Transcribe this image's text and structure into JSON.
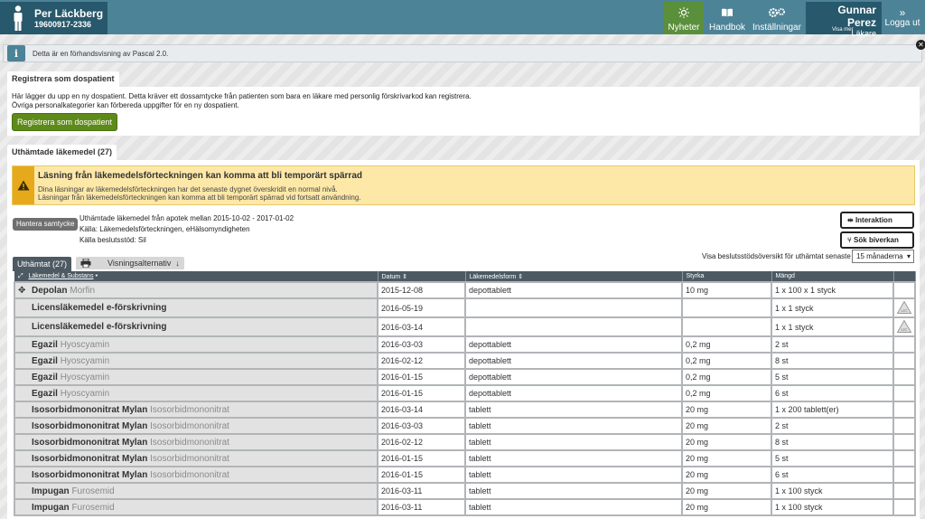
{
  "header": {
    "patient_name": "Per Läckberg",
    "patient_id": "19600917-2336",
    "nav": [
      {
        "label": "Nyheter"
      },
      {
        "label": "Handbok"
      },
      {
        "label": "Inställningar"
      }
    ],
    "user_name": "Gunnar Perez",
    "user_role": "Läkare",
    "user_more": "Visa mer",
    "logout": "Logga ut"
  },
  "info": {
    "text": "Detta är en förhandsvisning av Pascal 2.0."
  },
  "dospatient": {
    "tab": "Registrera som dospatient",
    "line1": "Här lägger du upp en ny dospatient. Detta kräver ett dossamtycke från patienten som bara en läkare med personlig förskrivarkod kan registrera.",
    "line2": "Övriga personalkategorier kan förbereda uppgifter för en ny dospatient.",
    "button": "Registrera som dospatient"
  },
  "uthamtade": {
    "tab": "Uthämtade läkemedel (27)",
    "warning_title": "Läsning från läkemedelsförteckningen kan komma att bli temporärt spärrad",
    "warning_line1": "Dina läsningar av läkemedelsförteckningen har det senaste dygnet överskridit en normal nivå.",
    "warning_line2": "Läsningar från läkemedelsförteckningen kan komma att bli temporärt spärrad vid fortsatt användning.",
    "consent_button": "Hantera samtycke",
    "source_line1": "Uthämtade läkemedel från apotek mellan 2015-10-02 - 2017-01-02",
    "source_line2": "Källa: Läkemedelsförteckningen, eHälsomyndigheten",
    "source_line3": "Källa beslutsstöd: Sil",
    "interaction_button": "Interaktion",
    "sideeffect_button": "Sök biverkan",
    "overview_label": "Visa beslutsstödsöversikt för uthämtat senaste",
    "period_select": "15 månaderna",
    "table_tab": "Uthämtat (27)",
    "view_tab": "Visningsalternativ",
    "columns": [
      "Läkemedel & Substans",
      "Datum",
      "Läkemedelsform",
      "Styrka",
      "Mängd"
    ],
    "rows": [
      {
        "name": "Depolan",
        "substance": "Morfin",
        "date": "2015-12-08",
        "form": "depottablett",
        "strength": "10 mg",
        "amount": "1 x 100 x 1 styck"
      },
      {
        "name": "Licensläkemedel e-förskrivning",
        "substance": "",
        "date": "2016-05-19",
        "form": "",
        "strength": "",
        "amount": "1 x 1 styck",
        "lic": "LIC"
      },
      {
        "name": "Licensläkemedel e-förskrivning",
        "substance": "",
        "date": "2016-03-14",
        "form": "",
        "strength": "",
        "amount": "1 x 1 styck",
        "lic": "LIC"
      },
      {
        "name": "Egazil",
        "substance": "Hyoscyamin",
        "date": "2016-03-03",
        "form": "depottablett",
        "strength": "0,2 mg",
        "amount": "2 st"
      },
      {
        "name": "Egazil",
        "substance": "Hyoscyamin",
        "date": "2016-02-12",
        "form": "depottablett",
        "strength": "0,2 mg",
        "amount": "8 st"
      },
      {
        "name": "Egazil",
        "substance": "Hyoscyamin",
        "date": "2016-01-15",
        "form": "depottablett",
        "strength": "0,2 mg",
        "amount": "5 st"
      },
      {
        "name": "Egazil",
        "substance": "Hyoscyamin",
        "date": "2016-01-15",
        "form": "depottablett",
        "strength": "0,2 mg",
        "amount": "6 st"
      },
      {
        "name": "Isosorbidmononitrat Mylan",
        "substance": "Isosorbidmononitrat",
        "date": "2016-03-14",
        "form": "tablett",
        "strength": "20 mg",
        "amount": "1 x 200 tablett(er)"
      },
      {
        "name": "Isosorbidmononitrat Mylan",
        "substance": "Isosorbidmononitrat",
        "date": "2016-03-03",
        "form": "tablett",
        "strength": "20 mg",
        "amount": "2 st"
      },
      {
        "name": "Isosorbidmononitrat Mylan",
        "substance": "Isosorbidmononitrat",
        "date": "2016-02-12",
        "form": "tablett",
        "strength": "20 mg",
        "amount": "8 st"
      },
      {
        "name": "Isosorbidmononitrat Mylan",
        "substance": "Isosorbidmononitrat",
        "date": "2016-01-15",
        "form": "tablett",
        "strength": "20 mg",
        "amount": "5 st"
      },
      {
        "name": "Isosorbidmononitrat Mylan",
        "substance": "Isosorbidmononitrat",
        "date": "2016-01-15",
        "form": "tablett",
        "strength": "20 mg",
        "amount": "6 st"
      },
      {
        "name": "Impugan",
        "substance": "Furosemid",
        "date": "2016-03-11",
        "form": "tablett",
        "strength": "20 mg",
        "amount": "1 x 100 styck"
      },
      {
        "name": "Impugan",
        "substance": "Furosemid",
        "date": "2016-03-11",
        "form": "tablett",
        "strength": "20 mg",
        "amount": "1 x 100 styck"
      }
    ]
  }
}
